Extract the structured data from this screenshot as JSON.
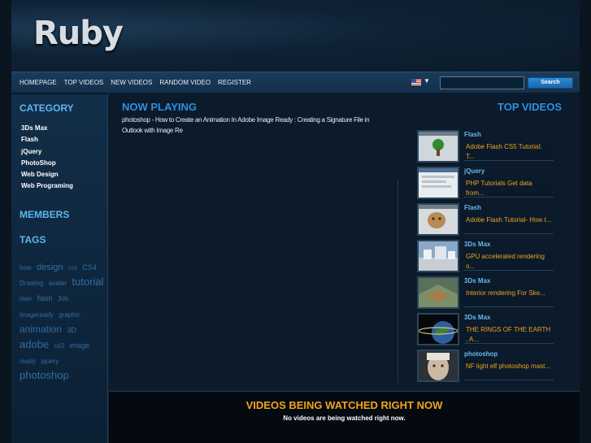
{
  "brand": {
    "logo": "Ruby"
  },
  "nav": {
    "links": [
      "HOMEPAGE",
      "TOP VIDEOS",
      "NEW VIDEOS",
      "RANDOM VIDEO",
      "REGISTER"
    ],
    "search_value": "",
    "search_button": "Search"
  },
  "sidebar": {
    "category_heading": "CATEGORY",
    "categories": [
      "3Ds Max",
      "Flash",
      "jQuery",
      "PhotoShop",
      "Web Design",
      "Web Programing"
    ],
    "members_heading": "MEMBERS",
    "tags_heading": "TAGS",
    "tags": [
      {
        "text": "how",
        "size": 8
      },
      {
        "text": "design",
        "size": 11
      },
      {
        "text": "cs3",
        "size": 7
      },
      {
        "text": "CS4",
        "size": 9
      },
      {
        "text": "Drawing",
        "size": 8
      },
      {
        "text": "avatar",
        "size": 8
      },
      {
        "text": "tutorial",
        "size": 13
      },
      {
        "text": "max",
        "size": 8
      },
      {
        "text": "flash",
        "size": 9
      },
      {
        "text": "3ds",
        "size": 8
      },
      {
        "text": "imageready",
        "size": 8
      },
      {
        "text": "graphic",
        "size": 8
      },
      {
        "text": "animation",
        "size": 12
      },
      {
        "text": "3D",
        "size": 9
      },
      {
        "text": "adobe",
        "size": 13
      },
      {
        "text": "cs3",
        "size": 8
      },
      {
        "text": "image",
        "size": 9
      },
      {
        "text": "ready",
        "size": 8
      },
      {
        "text": "jquery",
        "size": 8
      },
      {
        "text": "photoshop",
        "size": 13
      }
    ]
  },
  "now_playing": {
    "heading": "NOW PLAYING",
    "description": "photoshop - How to Create an Animation In Adobe Image Ready : Creating a Signature File in Outlook with Image Re"
  },
  "top_videos": {
    "heading": "TOP VIDEOS",
    "items": [
      {
        "category": "Flash",
        "title": "Adobe Flash CS5 Tutorial: T...",
        "thumb": "tree"
      },
      {
        "category": "jQuery",
        "title": "PHP Tutorials Get data from...",
        "thumb": "web"
      },
      {
        "category": "Flash",
        "title": "Adobe Flash Tutorial- How t...",
        "thumb": "face"
      },
      {
        "category": "3Ds Max",
        "title": "GPU accelerated rendering o...",
        "thumb": "building"
      },
      {
        "category": "3Ds Max",
        "title": "Interior rendering For Ske...",
        "thumb": "room"
      },
      {
        "category": "3Ds Max",
        "title": "THE RINGS OF THE EARTH , A...",
        "thumb": "earth"
      },
      {
        "category": "photoshop",
        "title": "NF light elf photoshop mast...",
        "thumb": "portrait"
      }
    ]
  },
  "watched": {
    "heading": "VIDEOS BEING WATCHED RIGHT NOW",
    "text": "No videos are being watched right now."
  }
}
